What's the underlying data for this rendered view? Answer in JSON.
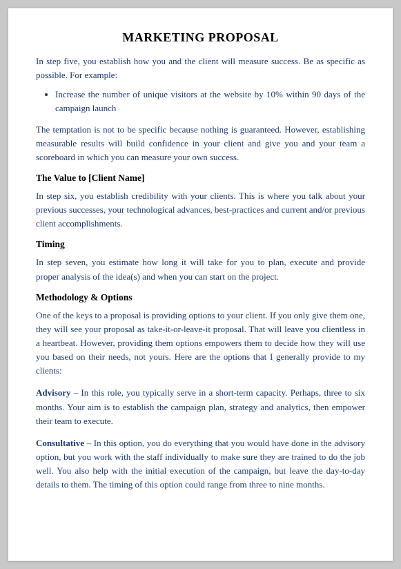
{
  "title": "MARKETING PROPOSAL",
  "intro": {
    "p1": "In step five, you establish how you and the client will measure success. Be as specific as possible. For example:",
    "bullet": "Increase the number of unique visitors at the website by 10% within 90 days of the campaign launch",
    "p2": "The temptation is not to be specific because nothing is guaranteed. However, establishing measurable results will build confidence in your client and give you and your team a scoreboard in which you can measure your own success."
  },
  "section_value": {
    "heading": "The Value to [Client Name]",
    "body": "In step six, you establish credibility with your clients. This is where you talk about your previous successes, your technological advances, best-practices and current and/or previous client accomplishments."
  },
  "section_timing": {
    "heading": "Timing",
    "body": "In step seven, you estimate how long it will take for you to plan, execute and provide proper analysis of the idea(s) and when you can start on the project."
  },
  "section_methodology": {
    "heading": "Methodology & Options",
    "body1": "One of the keys to a proposal is providing options to your client. If you only give them one, they will see your proposal as take-it-or-leave-it proposal. That will leave you clientless in a heartbeat. However, providing them options empowers them to decide how they will use you based on their needs, not yours. Here are the options that I generally provide to my clients:",
    "advisory_label": "Advisory",
    "advisory_body": " – In this role, you typically serve in a short-term capacity. Perhaps, three to six months. Your aim is to establish the campaign plan, strategy and analytics, then empower their team to execute.",
    "consultative_label": "Consultative",
    "consultative_body": " – In this option, you do everything that you would have done in the advisory option, but you work with the staff individually to make sure they are trained to do the job well. You also help with the initial execution of the campaign, but leave the day-to-day details to them. The timing of this option could range from three to nine months."
  }
}
